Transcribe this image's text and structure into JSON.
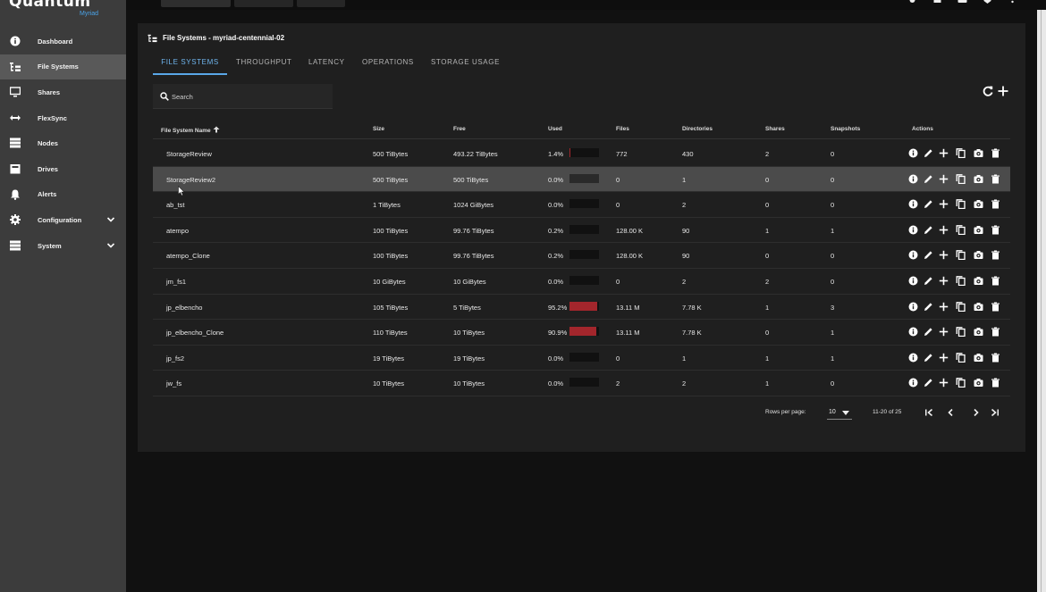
{
  "brand": {
    "name": "Quantum",
    "sub": "Myriad"
  },
  "sidebar": {
    "items": [
      {
        "label": "Dashboard",
        "icon": "info-icon"
      },
      {
        "label": "File Systems",
        "icon": "file-systems-icon",
        "active": true
      },
      {
        "label": "Shares",
        "icon": "shares-icon"
      },
      {
        "label": "FlexSync",
        "icon": "flexsync-icon"
      },
      {
        "label": "Nodes",
        "icon": "nodes-icon"
      },
      {
        "label": "Drives",
        "icon": "drives-icon"
      },
      {
        "label": "Alerts",
        "icon": "bell-icon"
      },
      {
        "label": "Configuration",
        "icon": "gear-icon",
        "expandable": true
      },
      {
        "label": "System",
        "icon": "system-icon",
        "expandable": true
      }
    ]
  },
  "page": {
    "title": "File Systems - myriad-centennial-02"
  },
  "tabs": [
    {
      "label": "FILE SYSTEMS",
      "active": true
    },
    {
      "label": "THROUGHPUT"
    },
    {
      "label": "LATENCY"
    },
    {
      "label": "OPERATIONS"
    },
    {
      "label": "STORAGE USAGE"
    }
  ],
  "search": {
    "placeholder": "Search",
    "value": ""
  },
  "table": {
    "columns": {
      "name": "File System Name",
      "size": "Size",
      "free": "Free",
      "used": "Used",
      "files": "Files",
      "directories": "Directories",
      "shares": "Shares",
      "snapshots": "Snapshots",
      "actions": "Actions"
    },
    "rows": [
      {
        "name": "StorageReview",
        "size": "500 TiBytes",
        "free": "493.22 TiBytes",
        "used": "1.4%",
        "used_pct": 1.4,
        "files": "772",
        "directories": "430",
        "shares": "2",
        "snapshots": "0"
      },
      {
        "name": "StorageReview2",
        "size": "500 TiBytes",
        "free": "500 TiBytes",
        "used": "0.0%",
        "used_pct": 0,
        "files": "0",
        "directories": "1",
        "shares": "0",
        "snapshots": "0",
        "highlight": true
      },
      {
        "name": "ab_tst",
        "size": "1 TiBytes",
        "free": "1024 GiBytes",
        "used": "0.0%",
        "used_pct": 0,
        "files": "0",
        "directories": "2",
        "shares": "0",
        "snapshots": "0"
      },
      {
        "name": "atempo",
        "size": "100 TiBytes",
        "free": "99.76 TiBytes",
        "used": "0.2%",
        "used_pct": 0.2,
        "files": "128.00 K",
        "directories": "90",
        "shares": "1",
        "snapshots": "1"
      },
      {
        "name": "atempo_Clone",
        "size": "100 TiBytes",
        "free": "99.76 TiBytes",
        "used": "0.2%",
        "used_pct": 0.2,
        "files": "128.00 K",
        "directories": "90",
        "shares": "0",
        "snapshots": "0"
      },
      {
        "name": "jm_fs1",
        "size": "10 GiBytes",
        "free": "10 GiBytes",
        "used": "0.0%",
        "used_pct": 0,
        "files": "0",
        "directories": "2",
        "shares": "2",
        "snapshots": "0"
      },
      {
        "name": "jp_elbencho",
        "size": "105 TiBytes",
        "free": "5 TiBytes",
        "used": "95.2%",
        "used_pct": 95.2,
        "files": "13.11 M",
        "directories": "7.78 K",
        "shares": "1",
        "snapshots": "3"
      },
      {
        "name": "jp_elbencho_Clone",
        "size": "110 TiBytes",
        "free": "10 TiBytes",
        "used": "90.9%",
        "used_pct": 90.9,
        "files": "13.11 M",
        "directories": "7.78 K",
        "shares": "0",
        "snapshots": "1"
      },
      {
        "name": "jp_fs2",
        "size": "19 TiBytes",
        "free": "19 TiBytes",
        "used": "0.0%",
        "used_pct": 0,
        "files": "0",
        "directories": "1",
        "shares": "1",
        "snapshots": "1"
      },
      {
        "name": "jw_fs",
        "size": "10 TiBytes",
        "free": "10 TiBytes",
        "used": "0.0%",
        "used_pct": 0,
        "files": "2",
        "directories": "2",
        "shares": "1",
        "snapshots": "0"
      }
    ]
  },
  "pagination": {
    "rows_per_page_label": "Rows per page:",
    "rows_per_page": "10",
    "range": "11-20 of 25"
  },
  "colors": {
    "accent": "#5aa7e8",
    "usage_bar": "#a3262c",
    "sidebar": "#3c3c3c",
    "card": "#1f1f1f"
  }
}
